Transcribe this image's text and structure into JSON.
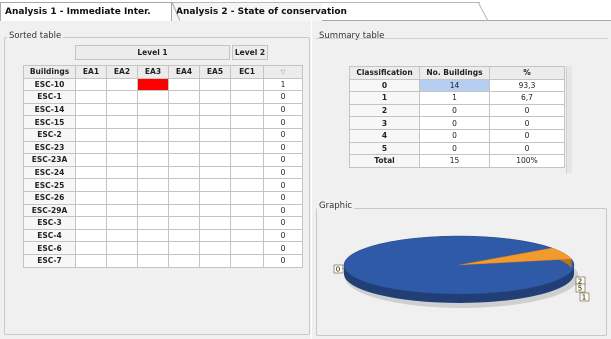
{
  "tabs": [
    {
      "label": "Analysis 1 - Immediate Inter."
    },
    {
      "label": "Analysis 2 - State of conservation"
    }
  ],
  "sorted": {
    "title": "Sorted table",
    "level1_label": "Level 1",
    "level2_label": "Level 2",
    "columns": [
      "Buildings",
      "EA1",
      "EA2",
      "EA3",
      "EA4",
      "EA5",
      "EC1"
    ],
    "filter_icon": "filter-icon",
    "rows": [
      {
        "name": "ESC-10",
        "count": "1"
      },
      {
        "name": "ESC-1",
        "count": "0"
      },
      {
        "name": "ESC-14",
        "count": "0"
      },
      {
        "name": "ESC-15",
        "count": "0"
      },
      {
        "name": "ESC-2",
        "count": "0"
      },
      {
        "name": "ESC-23",
        "count": "0"
      },
      {
        "name": "ESC-23A",
        "count": "0"
      },
      {
        "name": "ESC-24",
        "count": "0"
      },
      {
        "name": "ESC-25",
        "count": "0"
      },
      {
        "name": "ESC-26",
        "count": "0"
      },
      {
        "name": "ESC-29A",
        "count": "0"
      },
      {
        "name": "ESC-3",
        "count": "0"
      },
      {
        "name": "ESC-4",
        "count": "0"
      },
      {
        "name": "ESC-6",
        "count": "0"
      },
      {
        "name": "ESC-7",
        "count": "0"
      }
    ],
    "highlight_color": "#ff0000"
  },
  "summary": {
    "title": "Summary table",
    "columns": [
      "Classification",
      "No. Buildings",
      "%"
    ],
    "rows": [
      {
        "cls": "0",
        "count": "14",
        "pct": "93,3"
      },
      {
        "cls": "1",
        "count": "1",
        "pct": "6,7"
      },
      {
        "cls": "2",
        "count": "0",
        "pct": "0"
      },
      {
        "cls": "3",
        "count": "0",
        "pct": "0"
      },
      {
        "cls": "4",
        "count": "0",
        "pct": "0"
      },
      {
        "cls": "5",
        "count": "0",
        "pct": "0"
      }
    ],
    "total": {
      "cls": "Total",
      "count": "15",
      "pct": "100%"
    }
  },
  "graphic": {
    "title": "Graphic",
    "colors": {
      "0": "#2f5aa8",
      "1": "#f29a2e"
    }
  },
  "chart_data": {
    "type": "pie",
    "categories": [
      "0",
      "1",
      "2",
      "5"
    ],
    "values": [
      14,
      1,
      0,
      0
    ],
    "title": ""
  }
}
